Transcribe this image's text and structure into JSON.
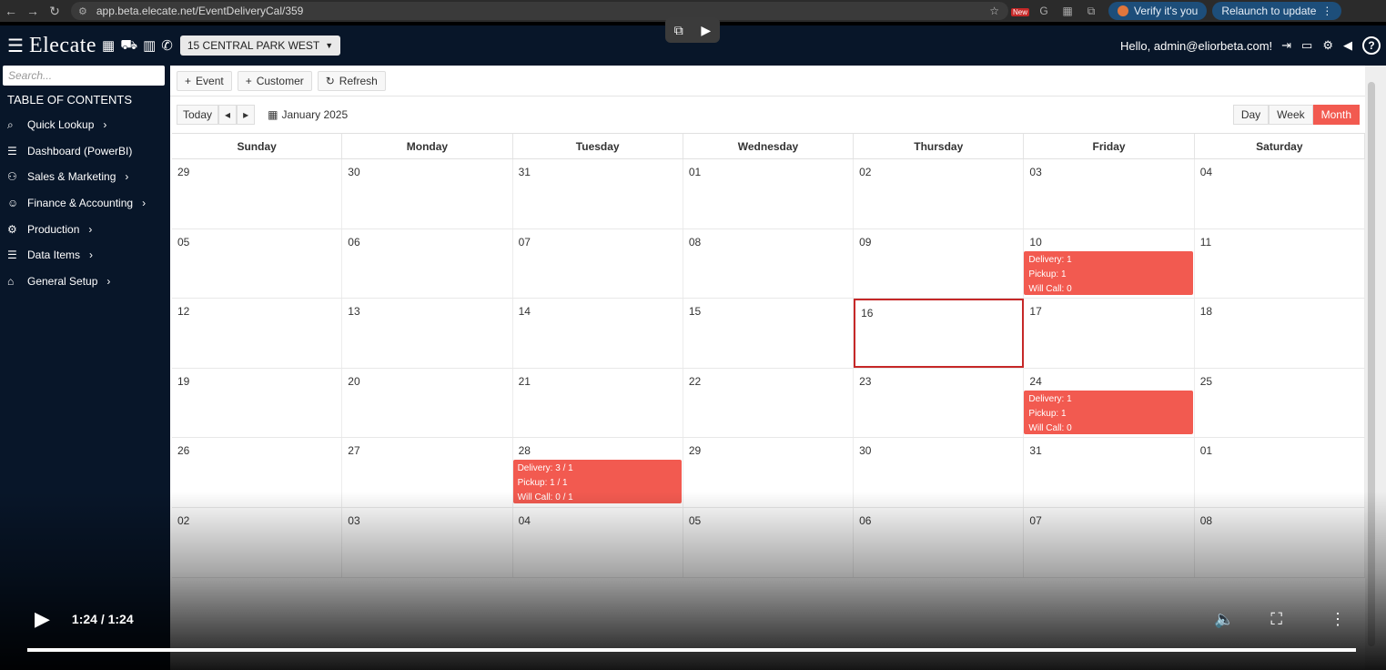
{
  "browser": {
    "url": "app.beta.elecate.net/EventDeliveryCal/359",
    "verify_label": "Verify it's you",
    "relaunch_label": "Relaunch to update",
    "new_badge": "New"
  },
  "header": {
    "logo": "Elecate",
    "location": "15 CENTRAL PARK WEST",
    "greeting": "Hello, admin@eliorbeta.com!"
  },
  "sidebar": {
    "search_placeholder": "Search...",
    "toc_title": "TABLE OF CONTENTS",
    "items": [
      {
        "label": "Quick Lookup",
        "icon": "search-icon",
        "chevron": true
      },
      {
        "label": "Dashboard (PowerBI)",
        "icon": "menu-icon",
        "chevron": false
      },
      {
        "label": "Sales & Marketing",
        "icon": "people-icon",
        "chevron": true
      },
      {
        "label": "Finance & Accounting",
        "icon": "user-money-icon",
        "chevron": true
      },
      {
        "label": "Production",
        "icon": "production-icon",
        "chevron": true
      },
      {
        "label": "Data Items",
        "icon": "list-icon",
        "chevron": true
      },
      {
        "label": "General Setup",
        "icon": "briefcase-icon",
        "chevron": true
      }
    ]
  },
  "toolbar": {
    "event_label": "Event",
    "customer_label": "Customer",
    "refresh_label": "Refresh"
  },
  "calendar": {
    "today_label": "Today",
    "month_label": "January 2025",
    "views": [
      "Day",
      "Week",
      "Month"
    ],
    "active_view": "Month",
    "days_of_week": [
      "Sunday",
      "Monday",
      "Tuesday",
      "Wednesday",
      "Thursday",
      "Friday",
      "Saturday"
    ],
    "weeks": [
      [
        "29",
        "30",
        "31",
        "01",
        "02",
        "03",
        "04"
      ],
      [
        "05",
        "06",
        "07",
        "08",
        "09",
        "10",
        "11"
      ],
      [
        "12",
        "13",
        "14",
        "15",
        "16",
        "17",
        "18"
      ],
      [
        "19",
        "20",
        "21",
        "22",
        "23",
        "24",
        "25"
      ],
      [
        "26",
        "27",
        "28",
        "29",
        "30",
        "31",
        "01"
      ],
      [
        "02",
        "03",
        "04",
        "05",
        "06",
        "07",
        "08"
      ]
    ],
    "today_cell": {
      "week": 2,
      "day": 4
    },
    "events": [
      {
        "week": 1,
        "day": 5,
        "lines": [
          "Delivery: 1",
          "Pickup: 1",
          "Will Call: 0"
        ]
      },
      {
        "week": 3,
        "day": 5,
        "lines": [
          "Delivery: 1",
          "Pickup: 1",
          "Will Call: 0"
        ]
      },
      {
        "week": 4,
        "day": 2,
        "lines": [
          "Delivery: 3 / 1",
          "Pickup: 1 / 1",
          "Will Call: 0 / 1"
        ]
      }
    ]
  },
  "video": {
    "time": "1:24 / 1:24",
    "progress_fraction": 1.0
  },
  "colors": {
    "accent": "#f25a50",
    "nav_bg": "#081629"
  }
}
